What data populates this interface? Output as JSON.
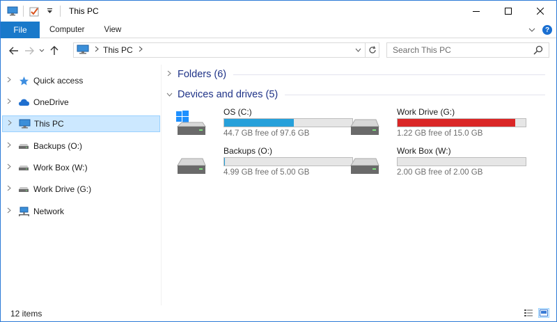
{
  "window": {
    "title": "This PC",
    "controls": {
      "minimize": "—",
      "maximize": "☐",
      "close": "✕"
    }
  },
  "ribbon": {
    "file_tab": "File",
    "tabs": [
      "Computer",
      "View"
    ],
    "expand_glyph": "⌄",
    "help_glyph": "?"
  },
  "address": {
    "crumb": "This PC",
    "search_placeholder": "Search This PC"
  },
  "nav": {
    "items": [
      {
        "label": "Quick access",
        "icon": "star-icon"
      },
      {
        "label": "OneDrive",
        "icon": "cloud-icon"
      },
      {
        "label": "This PC",
        "icon": "computer-icon",
        "selected": true
      },
      {
        "label": "Backups (O:)",
        "icon": "drive-icon"
      },
      {
        "label": "Work Box (W:)",
        "icon": "drive-icon"
      },
      {
        "label": "Work Drive (G:)",
        "icon": "drive-icon"
      },
      {
        "label": "Network",
        "icon": "network-icon"
      }
    ]
  },
  "content": {
    "folders_header": "Folders (6)",
    "devices_header": "Devices and drives (5)",
    "drives": [
      {
        "name": "OS (C:)",
        "free_text": "44.7 GB free of 97.6 GB",
        "used_fraction": 0.542,
        "bar_color": "#26a0da",
        "icon": "windows-drive-icon"
      },
      {
        "name": "Work Drive (G:)",
        "free_text": "1.22 GB free of 15.0 GB",
        "used_fraction": 0.919,
        "bar_color": "#da2626",
        "icon": "drive-icon"
      },
      {
        "name": "Backups (O:)",
        "free_text": "4.99 GB free of 5.00 GB",
        "used_fraction": 0.002,
        "bar_color": "#26a0da",
        "icon": "drive-icon"
      },
      {
        "name": "Work Box (W:)",
        "free_text": "2.00 GB free of 2.00 GB",
        "used_fraction": 0.0,
        "bar_color": "#26a0da",
        "icon": "drive-icon"
      }
    ]
  },
  "status": {
    "item_count": "12 items"
  }
}
